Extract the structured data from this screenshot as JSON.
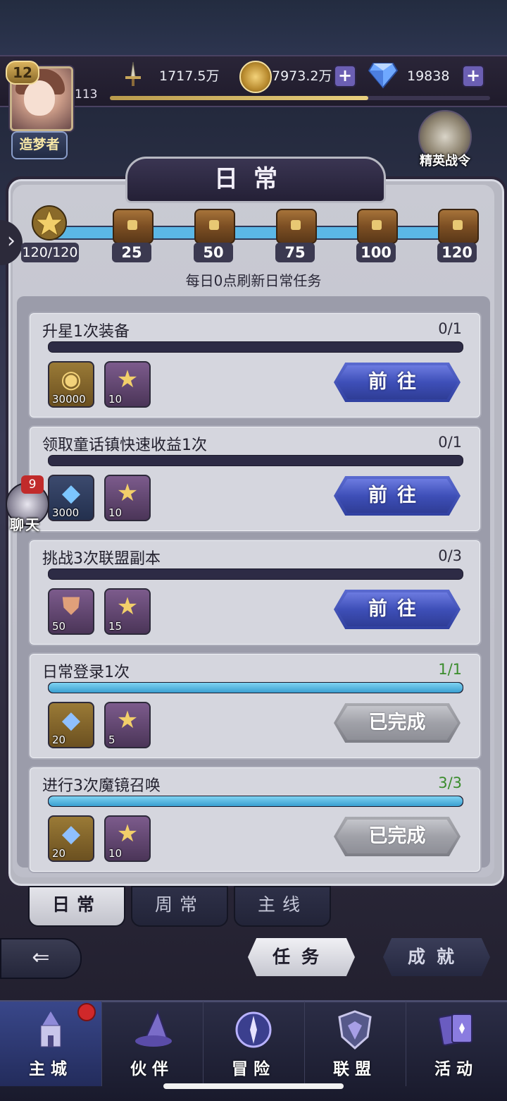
{
  "player": {
    "level": "12",
    "exp_level": "113",
    "title": "造梦者",
    "exp_progress": 0.68
  },
  "resources": {
    "power": "1717.5万",
    "coins": "7973.2万",
    "gems": "19838"
  },
  "elite_pass": {
    "label": "精英战令"
  },
  "panel": {
    "title": "日常",
    "refresh_note": "每日0点刷新日常任务"
  },
  "milestones": {
    "current": "120/120",
    "chests": [
      "25",
      "50",
      "75",
      "100",
      "120"
    ]
  },
  "tasks": [
    {
      "title": "升星1次装备",
      "count": "0/1",
      "progress": 0,
      "rewards": [
        {
          "icon": "gold-coin-icon",
          "qty": "30000"
        },
        {
          "icon": "activity-star-icon",
          "qty": "10"
        }
      ],
      "button": "前往",
      "done": false
    },
    {
      "title": "领取童话镇快速收益1次",
      "count": "0/1",
      "progress": 0,
      "rewards": [
        {
          "icon": "blue-crystal-icon",
          "qty": "3000"
        },
        {
          "icon": "activity-star-icon",
          "qty": "10"
        }
      ],
      "button": "前往",
      "done": false
    },
    {
      "title": "挑战3次联盟副本",
      "count": "0/3",
      "progress": 0,
      "rewards": [
        {
          "icon": "alliance-crest-icon",
          "qty": "50"
        },
        {
          "icon": "activity-star-icon",
          "qty": "15"
        }
      ],
      "button": "前往",
      "done": false
    },
    {
      "title": "日常登录1次",
      "count": "1/1",
      "progress": 1,
      "rewards": [
        {
          "icon": "diamond-icon",
          "qty": "20"
        },
        {
          "icon": "activity-star-icon",
          "qty": "5"
        }
      ],
      "button": "已完成",
      "done": true
    },
    {
      "title": "进行3次魔镜召唤",
      "count": "3/3",
      "progress": 1,
      "rewards": [
        {
          "icon": "diamond-icon",
          "qty": "20"
        },
        {
          "icon": "activity-star-icon",
          "qty": "10"
        }
      ],
      "button": "已完成",
      "done": true
    }
  ],
  "chat": {
    "badge": "9",
    "label": "聊天"
  },
  "tabs": [
    "日常",
    "周常",
    "主线"
  ],
  "subtabs": {
    "tasks": "任务",
    "achievements": "成就"
  },
  "nav": [
    {
      "label": "主城",
      "icon": "castle-icon"
    },
    {
      "label": "伙伴",
      "icon": "witch-hat-icon"
    },
    {
      "label": "冒险",
      "icon": "compass-icon"
    },
    {
      "label": "联盟",
      "icon": "shield-icon"
    },
    {
      "label": "活动",
      "icon": "cards-icon"
    }
  ]
}
